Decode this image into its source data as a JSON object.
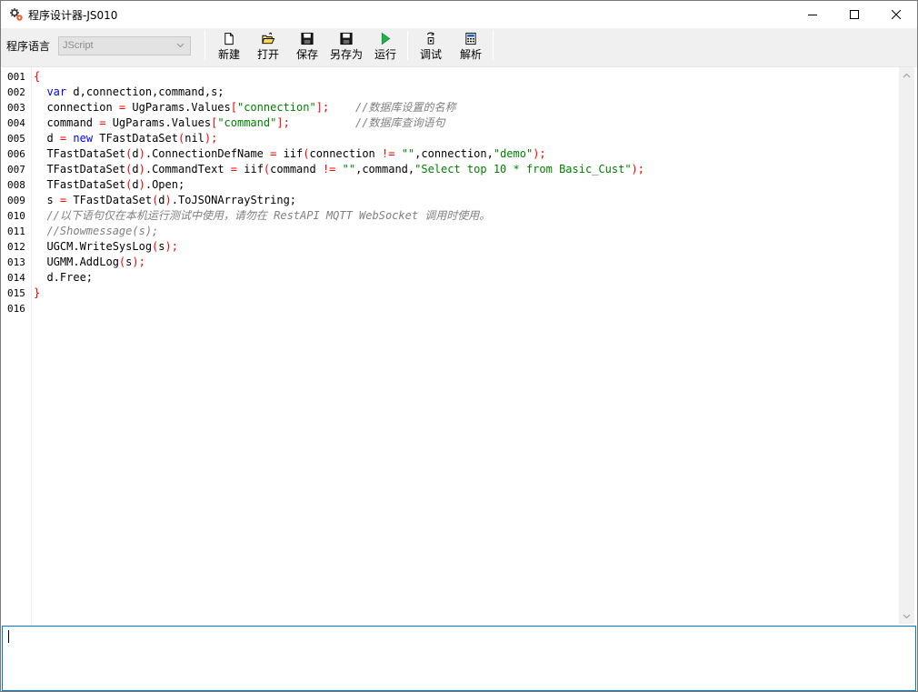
{
  "window": {
    "title": "程序设计器-JS010"
  },
  "toolbar": {
    "language_label": "程序语言",
    "language_value": "JScript",
    "buttons": {
      "new": "新建",
      "open": "打开",
      "save": "保存",
      "save_as": "另存为",
      "run": "运行",
      "debug": "调试",
      "parse": "解析"
    }
  },
  "editor": {
    "line_numbers": [
      "001",
      "002",
      "003",
      "004",
      "005",
      "006",
      "007",
      "008",
      "009",
      "010",
      "011",
      "012",
      "013",
      "014",
      "015",
      "016"
    ],
    "lines": [
      [
        {
          "t": "{",
          "c": "op"
        }
      ],
      [
        {
          "t": "  "
        },
        {
          "t": "var",
          "c": "kw"
        },
        {
          "t": " d,connection,command,s;"
        }
      ],
      [
        {
          "t": "  connection "
        },
        {
          "t": "=",
          "c": "op"
        },
        {
          "t": " UgParams.Values"
        },
        {
          "t": "[",
          "c": "op"
        },
        {
          "t": "\"connection\"",
          "c": "str"
        },
        {
          "t": "];",
          "c": "op"
        },
        {
          "t": "    "
        },
        {
          "t": "//数据库设置的名称",
          "c": "cmt"
        }
      ],
      [
        {
          "t": "  command "
        },
        {
          "t": "=",
          "c": "op"
        },
        {
          "t": " UgParams.Values"
        },
        {
          "t": "[",
          "c": "op"
        },
        {
          "t": "\"command\"",
          "c": "str"
        },
        {
          "t": "];",
          "c": "op"
        },
        {
          "t": "          "
        },
        {
          "t": "//数据库查询语句",
          "c": "cmt"
        }
      ],
      [
        {
          "t": "  d "
        },
        {
          "t": "=",
          "c": "op"
        },
        {
          "t": " "
        },
        {
          "t": "new",
          "c": "kw"
        },
        {
          "t": " TFastDataSet"
        },
        {
          "t": "(",
          "c": "op"
        },
        {
          "t": "nil"
        },
        {
          "t": ");",
          "c": "op"
        }
      ],
      [
        {
          "t": "  TFastDataSet"
        },
        {
          "t": "(",
          "c": "op"
        },
        {
          "t": "d"
        },
        {
          "t": ")",
          "c": "op"
        },
        {
          "t": ".ConnectionDefName "
        },
        {
          "t": "=",
          "c": "op"
        },
        {
          "t": " iif"
        },
        {
          "t": "(",
          "c": "op"
        },
        {
          "t": "connection "
        },
        {
          "t": "!=",
          "c": "op"
        },
        {
          "t": " "
        },
        {
          "t": "\"\"",
          "c": "str"
        },
        {
          "t": ",connection,"
        },
        {
          "t": "\"demo\"",
          "c": "str"
        },
        {
          "t": ");",
          "c": "op"
        }
      ],
      [
        {
          "t": "  TFastDataSet"
        },
        {
          "t": "(",
          "c": "op"
        },
        {
          "t": "d"
        },
        {
          "t": ")",
          "c": "op"
        },
        {
          "t": ".CommandText "
        },
        {
          "t": "=",
          "c": "op"
        },
        {
          "t": " iif"
        },
        {
          "t": "(",
          "c": "op"
        },
        {
          "t": "command "
        },
        {
          "t": "!=",
          "c": "op"
        },
        {
          "t": " "
        },
        {
          "t": "\"\"",
          "c": "str"
        },
        {
          "t": ",command,"
        },
        {
          "t": "\"Select top 10 * from Basic_Cust\"",
          "c": "str"
        },
        {
          "t": ");",
          "c": "op"
        }
      ],
      [
        {
          "t": "  TFastDataSet"
        },
        {
          "t": "(",
          "c": "op"
        },
        {
          "t": "d"
        },
        {
          "t": ")",
          "c": "op"
        },
        {
          "t": ".Open;"
        }
      ],
      [
        {
          "t": "  s "
        },
        {
          "t": "=",
          "c": "op"
        },
        {
          "t": " TFastDataSet"
        },
        {
          "t": "(",
          "c": "op"
        },
        {
          "t": "d"
        },
        {
          "t": ")",
          "c": "op"
        },
        {
          "t": ".ToJSONArrayString;"
        }
      ],
      [
        {
          "t": "  "
        },
        {
          "t": "//以下语句仅在本机运行测试中使用，请勿在 RestAPI MQTT WebSocket 调用时使用。",
          "c": "cmt"
        }
      ],
      [
        {
          "t": "  "
        },
        {
          "t": "//Showmessage(s);",
          "c": "cmt"
        }
      ],
      [
        {
          "t": "  UGCM.WriteSysLog"
        },
        {
          "t": "(",
          "c": "op"
        },
        {
          "t": "s"
        },
        {
          "t": ");",
          "c": "op"
        }
      ],
      [
        {
          "t": "  UGMM.AddLog"
        },
        {
          "t": "(",
          "c": "op"
        },
        {
          "t": "s"
        },
        {
          "t": ");",
          "c": "op"
        }
      ],
      [
        {
          "t": "  d.Free;"
        }
      ],
      [
        {
          "t": "}",
          "c": "op"
        }
      ],
      []
    ]
  },
  "output": {
    "text": ""
  }
}
